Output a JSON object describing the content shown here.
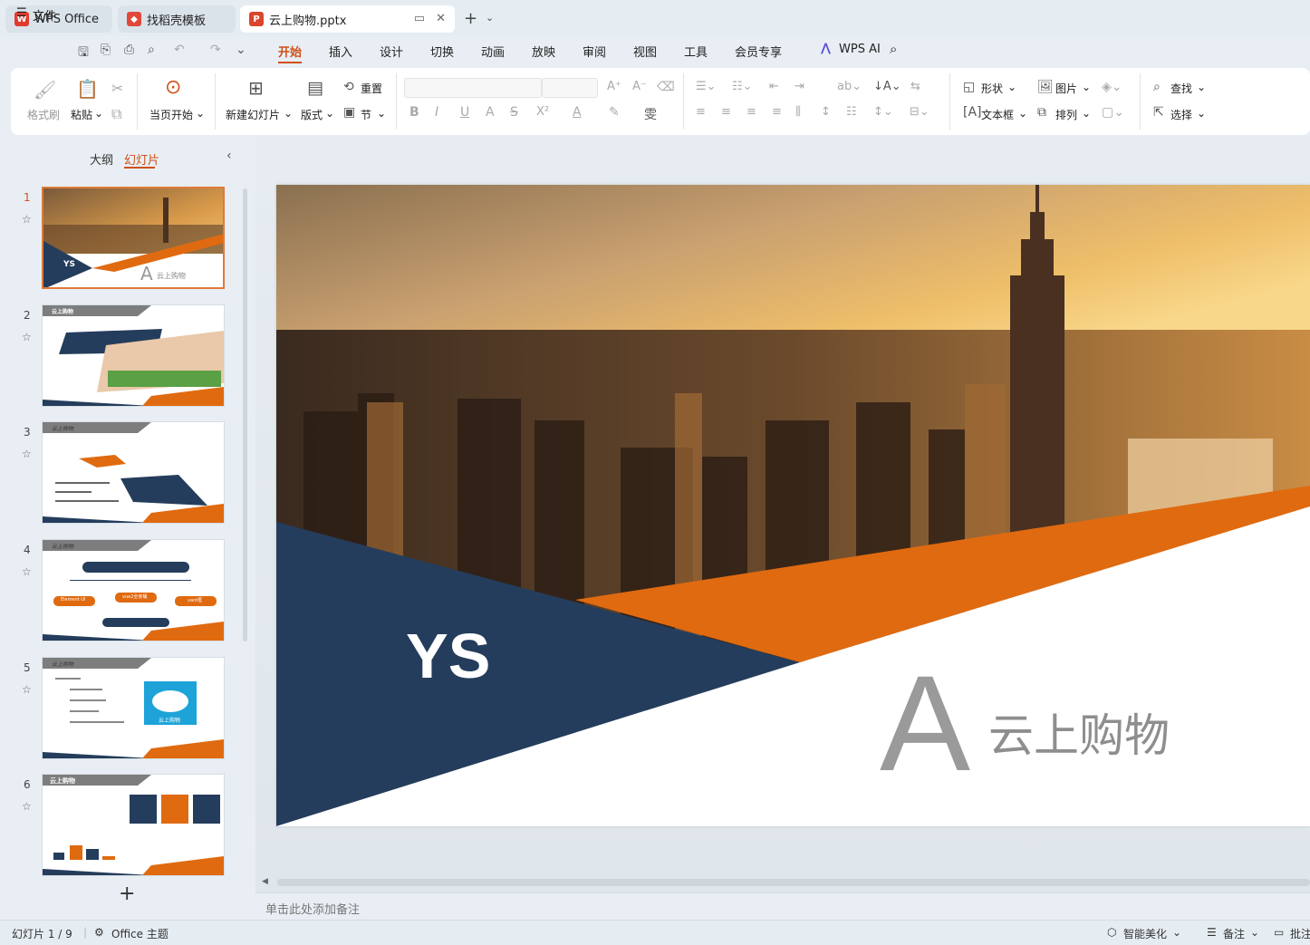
{
  "tabs": [
    {
      "label": "WPS Office",
      "icon": "wps-logo-icon"
    },
    {
      "label": "找稻壳模板",
      "icon": "docer-icon"
    },
    {
      "label": "云上购物.pptx",
      "icon": "pptx-file-icon"
    }
  ],
  "menu": {
    "file": "文件",
    "items": [
      "开始",
      "插入",
      "设计",
      "切换",
      "动画",
      "放映",
      "审阅",
      "视图",
      "工具",
      "会员专享"
    ],
    "active": "开始",
    "ai": "WPS AI"
  },
  "ribbon": {
    "format_painter": "格式刷",
    "paste": "粘贴",
    "from_current": "当页开始",
    "new_slide": "新建幻灯片",
    "layout": "版式",
    "reset": "重置",
    "section": "节",
    "shape": "形状",
    "picture": "图片",
    "textbox": "文本框",
    "arrange": "排列",
    "find": "查找",
    "select": "选择"
  },
  "left_panel": {
    "outline_tab": "大纲",
    "slides_tab": "幻灯片",
    "slide_numbers": [
      "1",
      "2",
      "3",
      "4",
      "5",
      "6"
    ],
    "thumb_labels": {
      "t1_badge": "YS",
      "t1_title": "云上购物",
      "t2_title": "云上购物",
      "t3_title": "云上购物",
      "t4_title": "云上购物",
      "t5_title": "云上购物",
      "t5_cloud": "云上购物",
      "t6_title": "云上购物",
      "t4_nodes": [
        "Element UI",
        "vue2全家桶",
        "vant框"
      ]
    }
  },
  "slide": {
    "badge": "YS",
    "letter": "A",
    "title": "云上购物",
    "colors": {
      "navy": "#253d5c",
      "orange": "#e06a10",
      "grey": "#9a9a9a"
    }
  },
  "notes_placeholder": "单击此处添加备注",
  "status": {
    "slide_counter": "幻灯片 1 / 9",
    "theme": "Office 主题",
    "beautify": "智能美化",
    "notes": "备注",
    "comments": "批注"
  }
}
